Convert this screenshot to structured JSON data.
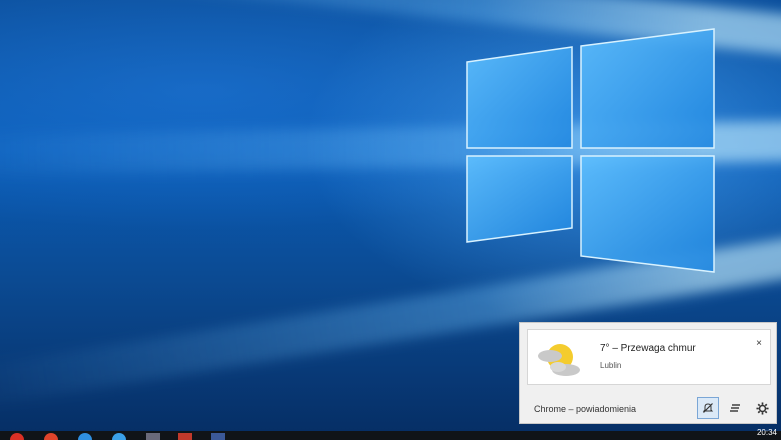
{
  "notification_panel": {
    "card": {
      "title": "7° – Przewaga chmur",
      "location": "Lublin",
      "close_label": "×",
      "icon": "partly-cloudy-icon"
    },
    "footer_label": "Chrome – powiadomienia",
    "buttons": [
      {
        "name": "do-not-disturb-button",
        "icon": "bell-off-icon",
        "active": true
      },
      {
        "name": "clear-all-button",
        "icon": "clear-list-icon",
        "active": false
      },
      {
        "name": "settings-button",
        "icon": "gear-icon",
        "active": false
      }
    ]
  },
  "taskbar": {
    "clock": "20:34",
    "icons": [
      "chrome-icon",
      "flame-app-icon",
      "browser-icon",
      "globe-icon",
      "app-icon",
      "mail-icon",
      "facebook-icon"
    ]
  },
  "colors": {
    "desktop_blue": "#0a5db8",
    "taskbar": "#101418",
    "panel_bg": "#f0f0f0",
    "sun": "#f4cc2e",
    "cloud": "#c9c9c9"
  }
}
